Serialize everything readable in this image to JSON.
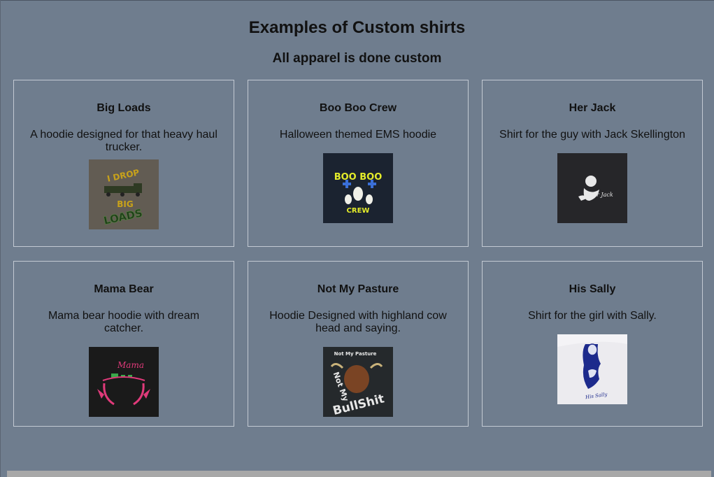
{
  "page": {
    "title": "Examples of Custom shirts",
    "subtitle": "All apparel is done custom"
  },
  "cards": [
    {
      "title": "Big Loads",
      "description": "A hoodie designed for that heavy haul trucker.",
      "image_text": [
        "I DROP",
        "BIG",
        "LOADS"
      ]
    },
    {
      "title": "Boo Boo Crew",
      "description": "Halloween themed EMS hoodie",
      "image_text": [
        "BOO BOO",
        "CREW"
      ]
    },
    {
      "title": "Her Jack",
      "description": "Shirt for the guy with Jack Skellington",
      "image_text": [
        "Her Jack"
      ]
    },
    {
      "title": "Mama Bear",
      "description": "Mama bear hoodie with dream catcher.",
      "image_text": [
        "Mama"
      ]
    },
    {
      "title": "Not My Pasture",
      "description": "Hoodie Designed with highland cow head and saying.",
      "image_text": [
        "Not My Pasture",
        "Not My",
        "BullShit"
      ]
    },
    {
      "title": "His Sally",
      "description": "Shirt for the girl with Sally.",
      "image_text": [
        "His Sally"
      ]
    }
  ]
}
